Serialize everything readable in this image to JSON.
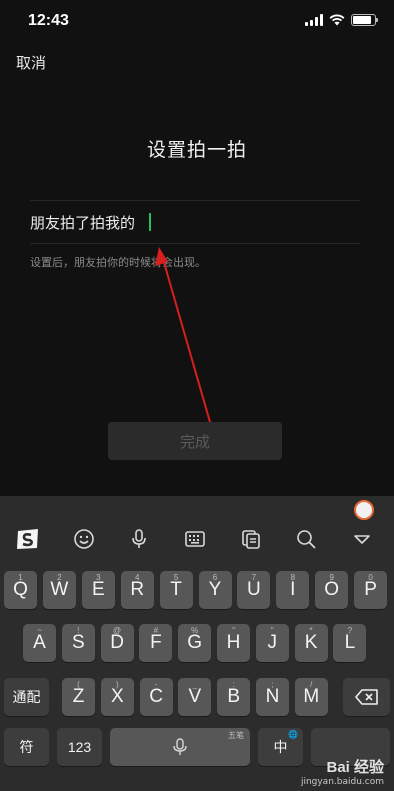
{
  "status_bar": {
    "time": "12:43",
    "signal_icon": "signal-icon",
    "wifi_icon": "wifi-icon",
    "battery_icon": "battery-icon",
    "battery_level": 0.85
  },
  "header": {
    "cancel_label": "取消"
  },
  "main": {
    "title": "设置拍一拍",
    "input_prefix": "朋友拍了拍我的",
    "input_value": "",
    "hint": "设置后，朋友拍你的时候将会出现。",
    "done_label": "完成"
  },
  "annotation": {
    "arrow_color": "#d91e1e"
  },
  "keyboard": {
    "toolbar": [
      "sogou-logo-icon",
      "emoji-icon",
      "microphone-icon",
      "keyboard-icon",
      "clipboard-icon",
      "search-icon",
      "collapse-icon"
    ],
    "row1": [
      {
        "label": "Q",
        "hint": "1"
      },
      {
        "label": "W",
        "hint": "2"
      },
      {
        "label": "E",
        "hint": "3"
      },
      {
        "label": "R",
        "hint": "4"
      },
      {
        "label": "T",
        "hint": "5"
      },
      {
        "label": "Y",
        "hint": "6"
      },
      {
        "label": "U",
        "hint": "7"
      },
      {
        "label": "I",
        "hint": "8"
      },
      {
        "label": "O",
        "hint": "9"
      },
      {
        "label": "P",
        "hint": "0"
      }
    ],
    "row2": [
      {
        "label": "A",
        "hint": "~"
      },
      {
        "label": "S",
        "hint": "!"
      },
      {
        "label": "D",
        "hint": "@"
      },
      {
        "label": "F",
        "hint": "#"
      },
      {
        "label": "G",
        "hint": "%"
      },
      {
        "label": "H",
        "hint": "\""
      },
      {
        "label": "J",
        "hint": "\""
      },
      {
        "label": "K",
        "hint": "*"
      },
      {
        "label": "L",
        "hint": "?"
      }
    ],
    "row3": [
      {
        "label": "Z",
        "hint": "("
      },
      {
        "label": "X",
        "hint": ")"
      },
      {
        "label": "C",
        "hint": "-"
      },
      {
        "label": "V",
        "hint": "_"
      },
      {
        "label": "B",
        "hint": ":"
      },
      {
        "label": "N",
        "hint": ";"
      },
      {
        "label": "M",
        "hint": "/"
      }
    ],
    "match_label": "通配",
    "symbol_label": "符",
    "num_label": "123",
    "space_hint": "五笔",
    "zh_label": "中",
    "globe_icon": "globe-icon",
    "delete_icon": "backspace-icon"
  },
  "watermark": {
    "logo": "Bai 经验",
    "url": "jingyan.baidu.com"
  }
}
